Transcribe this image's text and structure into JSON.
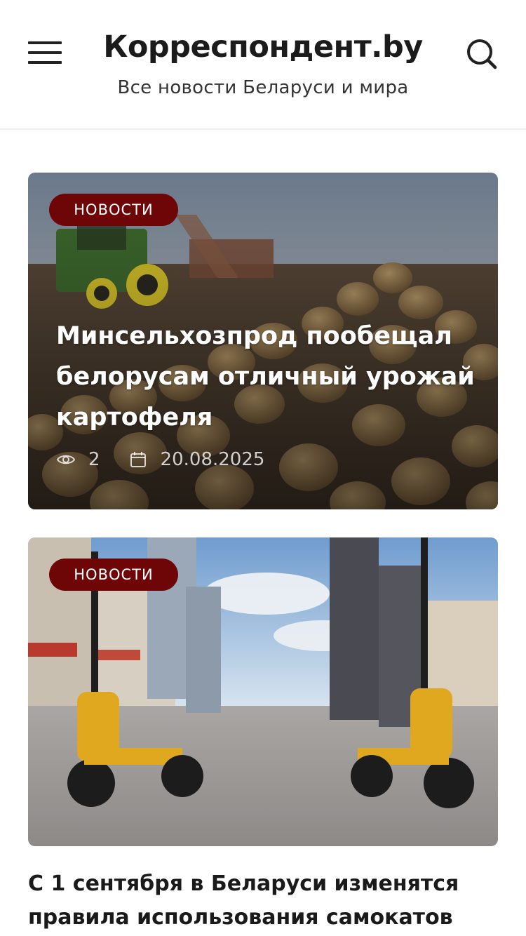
{
  "header": {
    "site_title": "Корреспондент.by",
    "site_subtitle": "Все новости Беларуси и мира",
    "menu_icon": "hamburger-menu-icon",
    "search_icon": "search-icon"
  },
  "articles": [
    {
      "category": "НОВОСТИ",
      "title": "Минсельхозпрод пообещал белорусам отличный урожай картофеля",
      "views": "2",
      "date": "20.08.2025",
      "image_alt": "Tractor harvesting potatoes in a field"
    },
    {
      "category": "НОВОСТИ",
      "title": "С 1 сентября в Беларуси изменятся правила использования самокатов",
      "image_alt": "Two people riding yellow electric scooters on a city street"
    }
  ],
  "colors": {
    "badge": "#6e0608",
    "text": "#1c1c1c"
  }
}
